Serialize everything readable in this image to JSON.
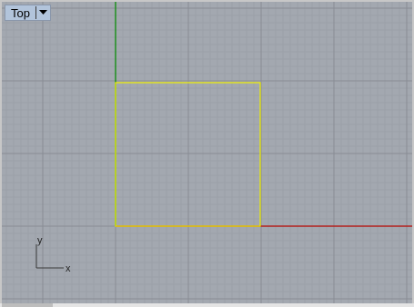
{
  "viewport": {
    "name": "Top",
    "background_color": "#a3a8b0",
    "grid_minor_color": "#9ba0a8",
    "grid_major_color": "#888c94",
    "x_axis_color": "#b4211d",
    "y_axis_color": "#1f8f1f",
    "selection_color": "#f0f000",
    "dropdown_icon": "caret-down-icon"
  },
  "widget": {
    "x_label": "x",
    "y_label": "y"
  }
}
